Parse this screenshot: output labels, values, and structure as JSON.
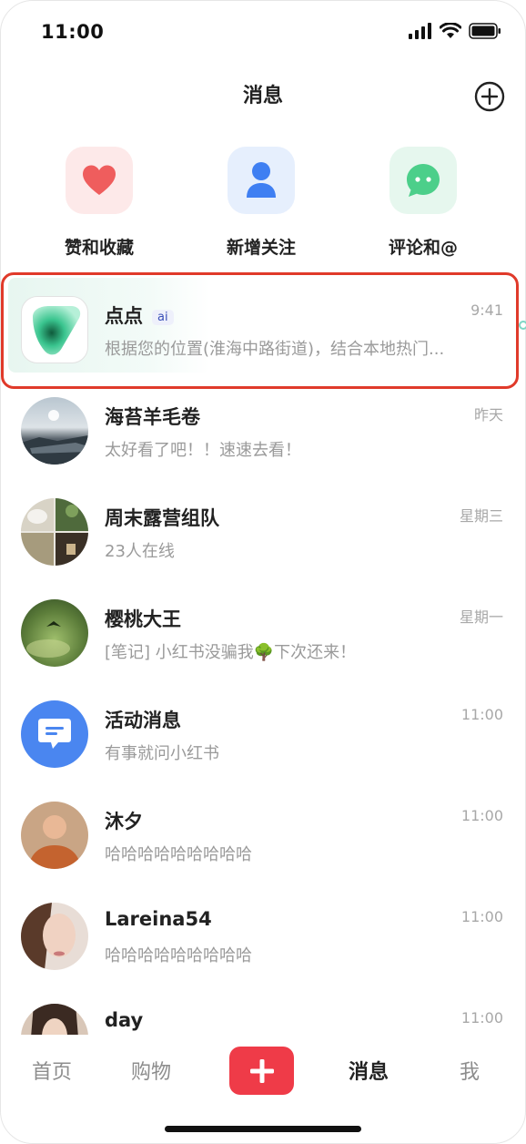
{
  "status_bar": {
    "time": "11:00"
  },
  "header": {
    "title": "消息"
  },
  "shortcuts": [
    {
      "label": "赞和收藏",
      "icon": "heart-icon",
      "color": "#ef5d5d"
    },
    {
      "label": "新增关注",
      "icon": "person-icon",
      "color": "#3f7ff2"
    },
    {
      "label": "评论和@",
      "icon": "chat-bubble-icon",
      "color": "#4ccf8a"
    }
  ],
  "conversations": [
    {
      "name": "点点",
      "badge": "ai",
      "preview": "根据您的位置(淮海中路街道)，结合本地热门...",
      "time": "9:41"
    },
    {
      "name": "海苔羊毛卷",
      "preview": "太好看了吧！！速速去看！",
      "time": "昨天"
    },
    {
      "name": "周末露营组队",
      "preview": "23人在线",
      "time": "星期三"
    },
    {
      "name": "樱桃大王",
      "preview": "[笔记] 小红书没骗我🌳下次还来！",
      "time": "星期一"
    },
    {
      "name": "活动消息",
      "preview": "有事就问小红书",
      "time": "11:00"
    },
    {
      "name": "沐夕",
      "preview": "哈哈哈哈哈哈哈哈哈",
      "time": "11:00"
    },
    {
      "name": "Lareina54",
      "preview": "哈哈哈哈哈哈哈哈哈",
      "time": "11:00"
    },
    {
      "name": "day",
      "preview": "",
      "time": "11:00"
    }
  ],
  "bottom_nav": {
    "home": "首页",
    "shop": "购物",
    "messages": "消息",
    "me": "我",
    "accent": "#ef3b48"
  }
}
